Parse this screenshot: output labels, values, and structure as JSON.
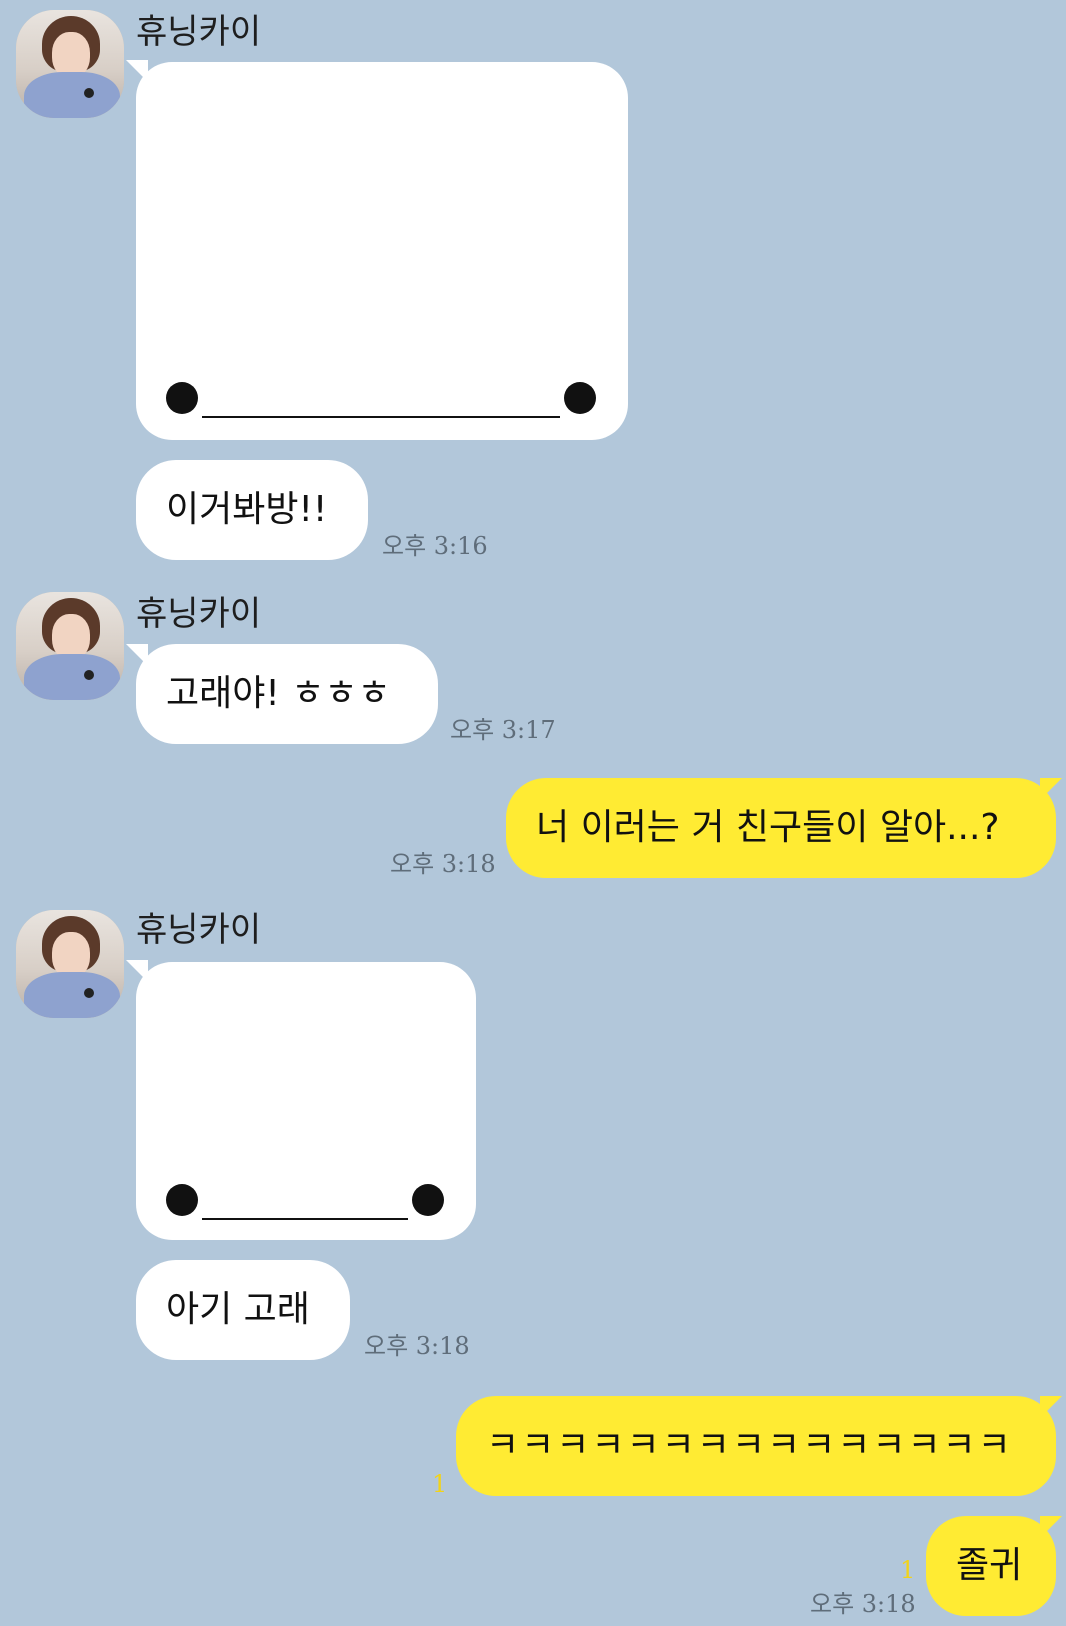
{
  "messages": [
    {
      "sender": "휴닝카이",
      "type": "image"
    },
    {
      "sender": "휴닝카이",
      "text": "이거봐방!!",
      "time": "오후 3:16"
    },
    {
      "sender": "휴닝카이",
      "text": "고래야! ㅎㅎㅎ",
      "time": "오후 3:17"
    },
    {
      "sender": "me",
      "text": "너 이러는 거 친구들이 알아...?",
      "time": "오후 3:18"
    },
    {
      "sender": "휴닝카이",
      "type": "image"
    },
    {
      "sender": "휴닝카이",
      "text": "아기 고래",
      "time": "오후 3:18"
    },
    {
      "sender": "me",
      "text": "ㅋㅋㅋㅋㅋㅋㅋㅋㅋㅋㅋㅋㅋㅋㅋ",
      "unread": "1"
    },
    {
      "sender": "me",
      "text": "졸귀",
      "unread": "1",
      "time": "오후 3:18"
    }
  ],
  "colors": {
    "background": "#b2c7da",
    "my_bubble": "#ffeb33",
    "their_bubble": "#ffffff",
    "unread": "#f2d318"
  }
}
